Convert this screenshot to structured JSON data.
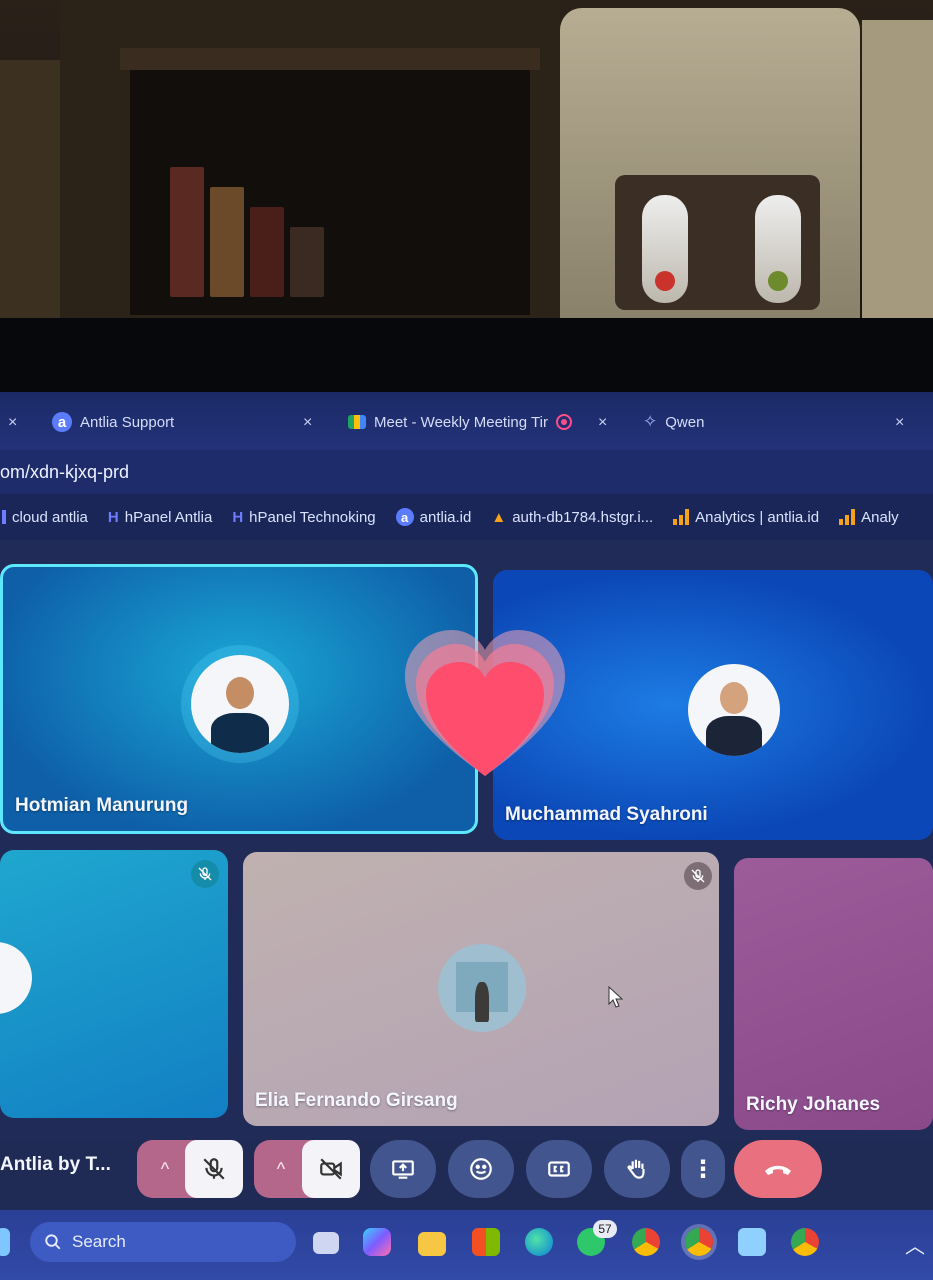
{
  "browser": {
    "tabs": [
      {
        "label": "Antlia Support",
        "close": "×"
      },
      {
        "label": "Meet - Weekly Meeting Tir",
        "close": "×"
      },
      {
        "label": "Qwen",
        "close": "×"
      }
    ],
    "left_close": "×",
    "address": "om/xdn-kjxq-prd",
    "bookmarks": [
      {
        "label": "cloud antlia"
      },
      {
        "label": "hPanel Antlia"
      },
      {
        "label": "hPanel Technoking"
      },
      {
        "label": "antlia.id"
      },
      {
        "label": "auth-db1784.hstgr.i..."
      },
      {
        "label": "Analytics | antlia.id"
      },
      {
        "label": "Analy"
      }
    ]
  },
  "meeting": {
    "title": "Antlia by T...",
    "participants": [
      {
        "name": "Hotmian Manurung"
      },
      {
        "name": "Muchammad Syahroni"
      },
      {
        "name": ""
      },
      {
        "name": "Elia Fernando Girsang"
      },
      {
        "name": "Richy Johanes"
      }
    ],
    "reaction": "heart"
  },
  "controls": {
    "caret": "^",
    "more": "⋮"
  },
  "taskbar": {
    "search_label": "Search",
    "whatsapp_badge": "57"
  },
  "colors": {
    "accent": "#5ee8ff",
    "end_call": "#e8707f",
    "mic_pill": "#b5678b",
    "taskbar": "#324aa8"
  }
}
